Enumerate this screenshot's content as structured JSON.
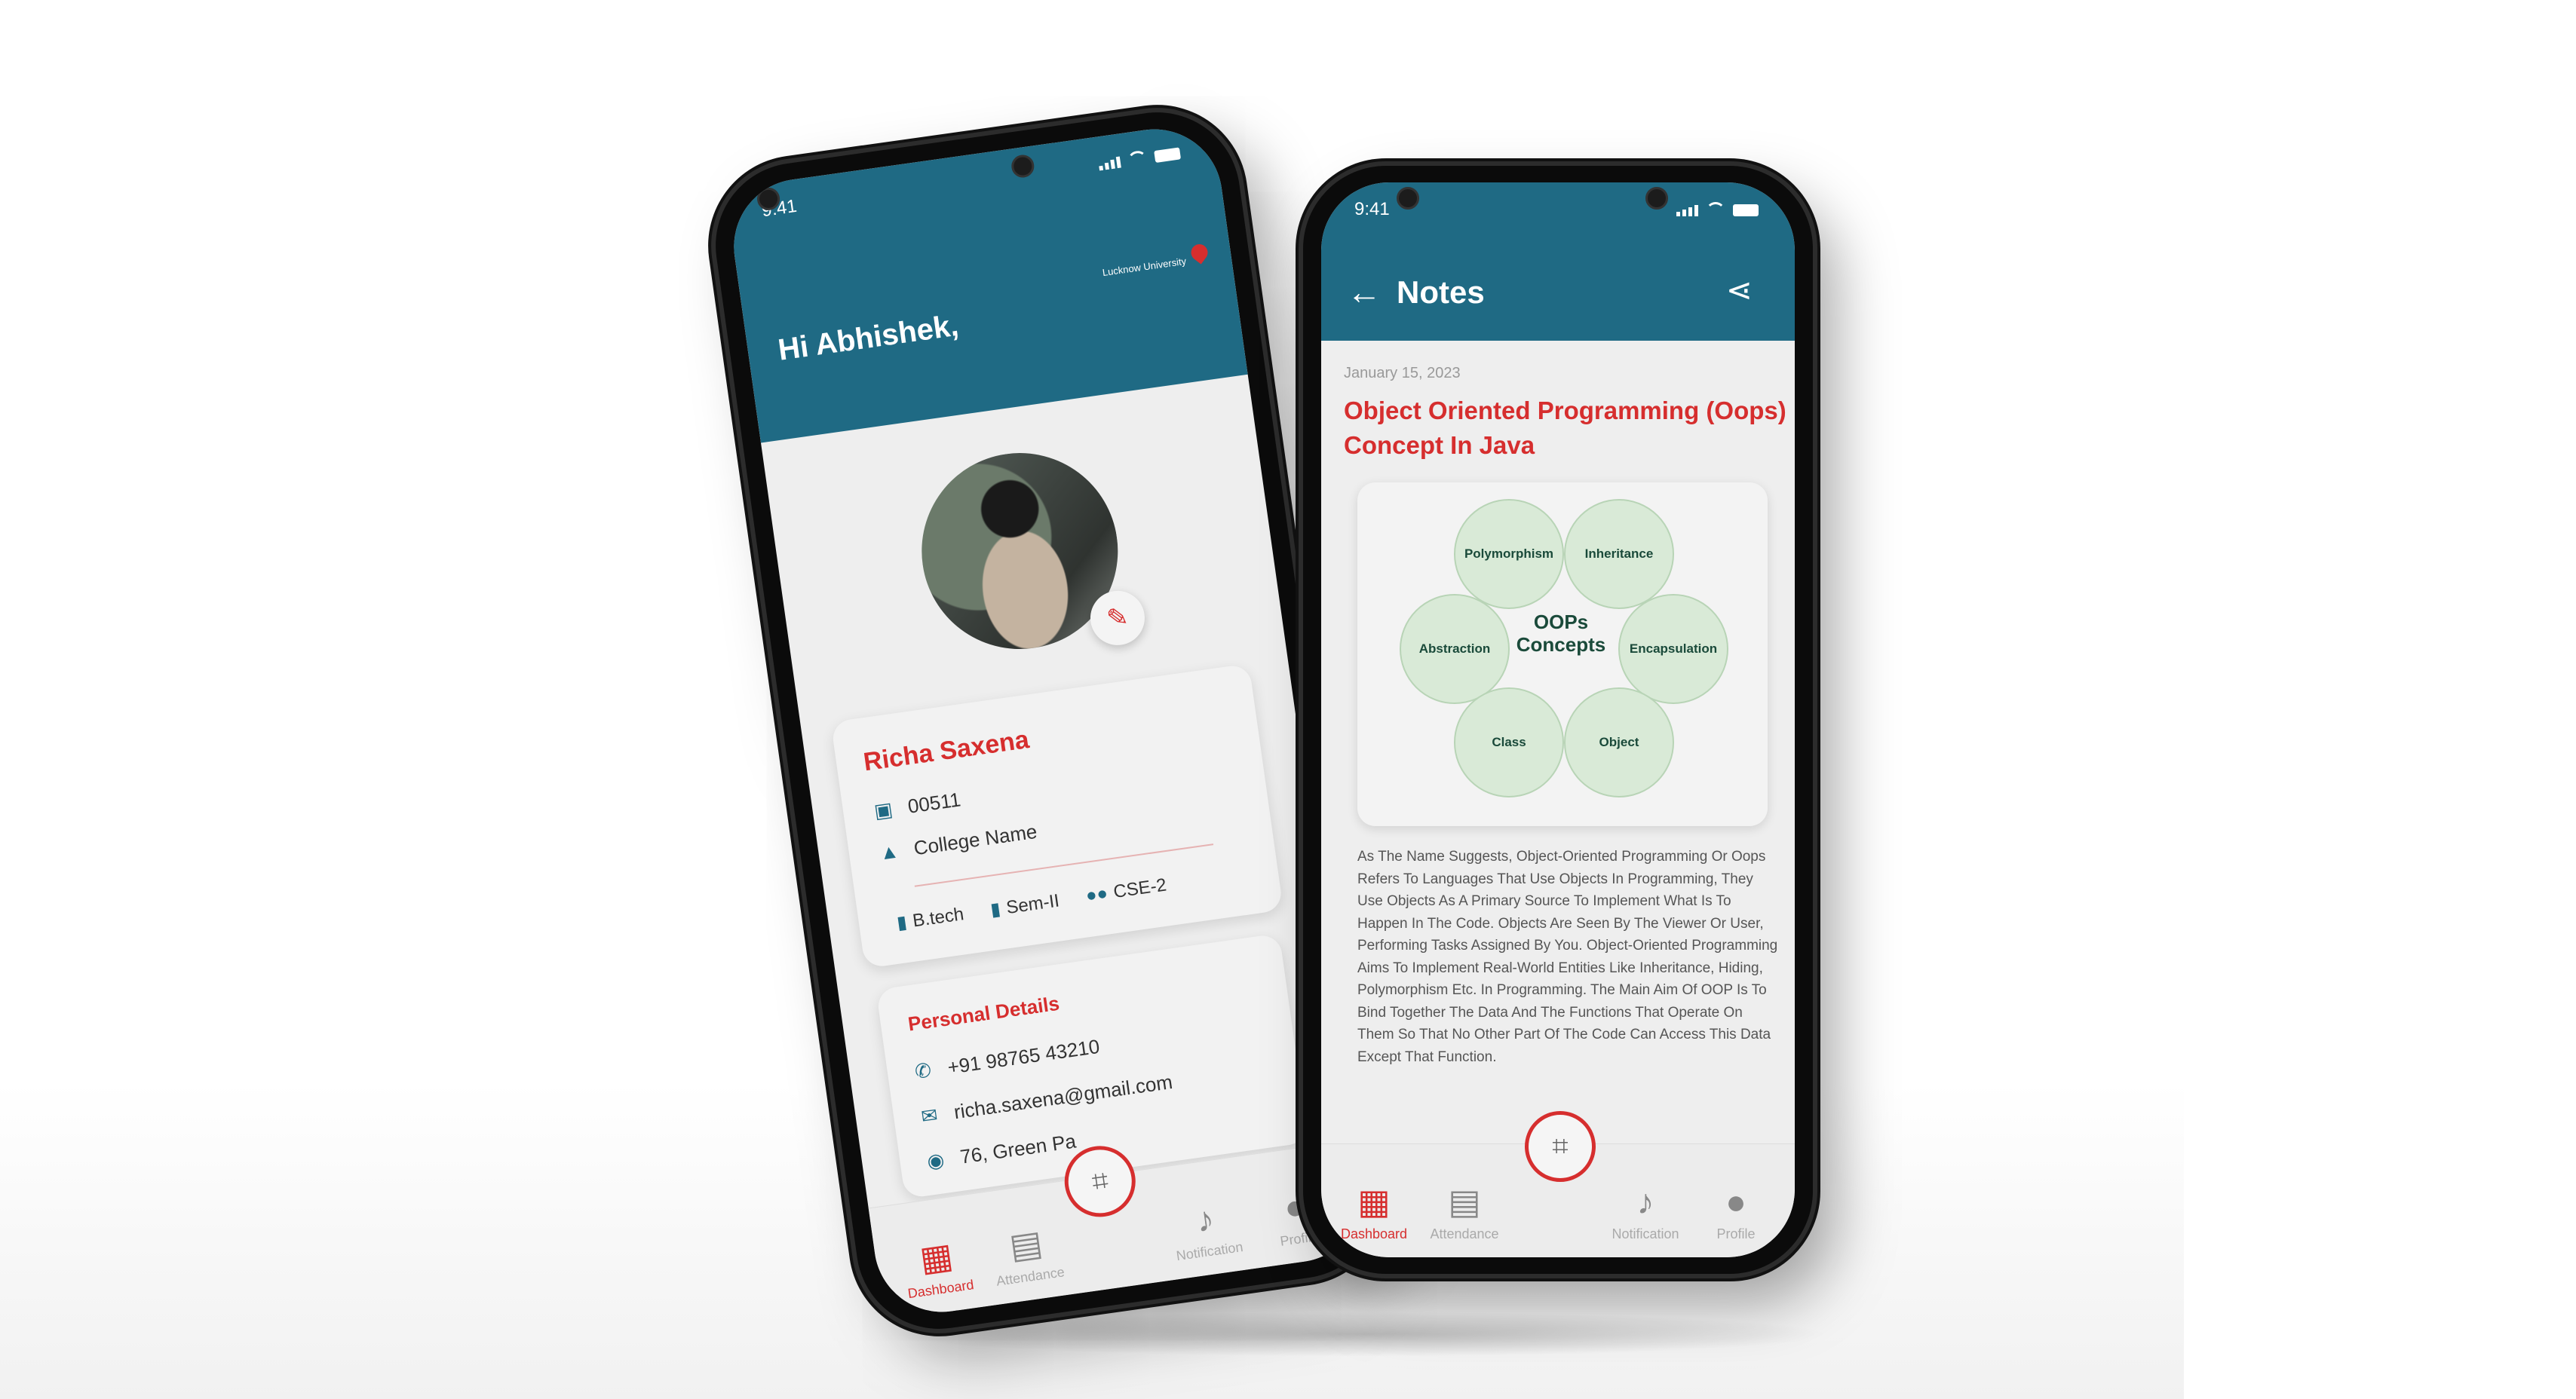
{
  "left_phone": {
    "status": {
      "time": "9:41"
    },
    "header": {
      "greeting": "Hi Abhishek,",
      "location": "Lucknow University"
    },
    "profile": {
      "name": "Richa Saxena",
      "id": "00511",
      "college": "College Name",
      "course": "B.tech",
      "semester": "Sem-II",
      "section": "CSE-2"
    },
    "personal_details": {
      "title": "Personal Details",
      "phone": "+91 98765 43210",
      "email": "richa.saxena@gmail.com",
      "address": "76, Green Pa"
    },
    "nav": {
      "dashboard": "Dashboard",
      "attendance": "Attendance",
      "notification": "Notification",
      "profile": "Profile"
    }
  },
  "right_phone": {
    "status": {
      "time": "9:41"
    },
    "header": {
      "title": "Notes"
    },
    "note": {
      "date": "January 15, 2023",
      "title": "Object Oriented Programming (Oops) Concept In Java",
      "diagram": {
        "center": "OOPs Concepts",
        "nodes": [
          "Polymorphism",
          "Inheritance",
          "Abstraction",
          "Encapsulation",
          "Class",
          "Object"
        ]
      },
      "body": "As The Name Suggests, Object-Oriented Programming Or Oops Refers To Languages That Use Objects In Programming, They Use Objects As A Primary Source To Implement What Is To Happen In The Code. Objects Are Seen By The Viewer Or User, Performing Tasks Assigned By You. Object-Oriented Programming Aims To Implement Real-World Entities Like Inheritance, Hiding, Polymorphism Etc. In Programming. The Main Aim Of OOP Is To Bind Together The Data And The Functions That Operate On Them So That No Other Part Of The Code Can Access This Data Except That Function."
    },
    "nav": {
      "dashboard": "Dashboard",
      "attendance": "Attendance",
      "notification": "Notification",
      "profile": "Profile"
    }
  },
  "colors": {
    "header": "#1f6a84",
    "accent": "#d62e2e",
    "bubble": "#d9ead7"
  },
  "icons": [
    "id-card-icon",
    "graduation-cap-icon",
    "book-icon",
    "group-icon",
    "phone-icon",
    "mail-icon",
    "location-icon",
    "dashboard-icon",
    "calendar-icon",
    "scan-icon",
    "bell-icon",
    "user-icon",
    "back-arrow-icon",
    "share-icon",
    "edit-icon",
    "map-pin-icon"
  ]
}
